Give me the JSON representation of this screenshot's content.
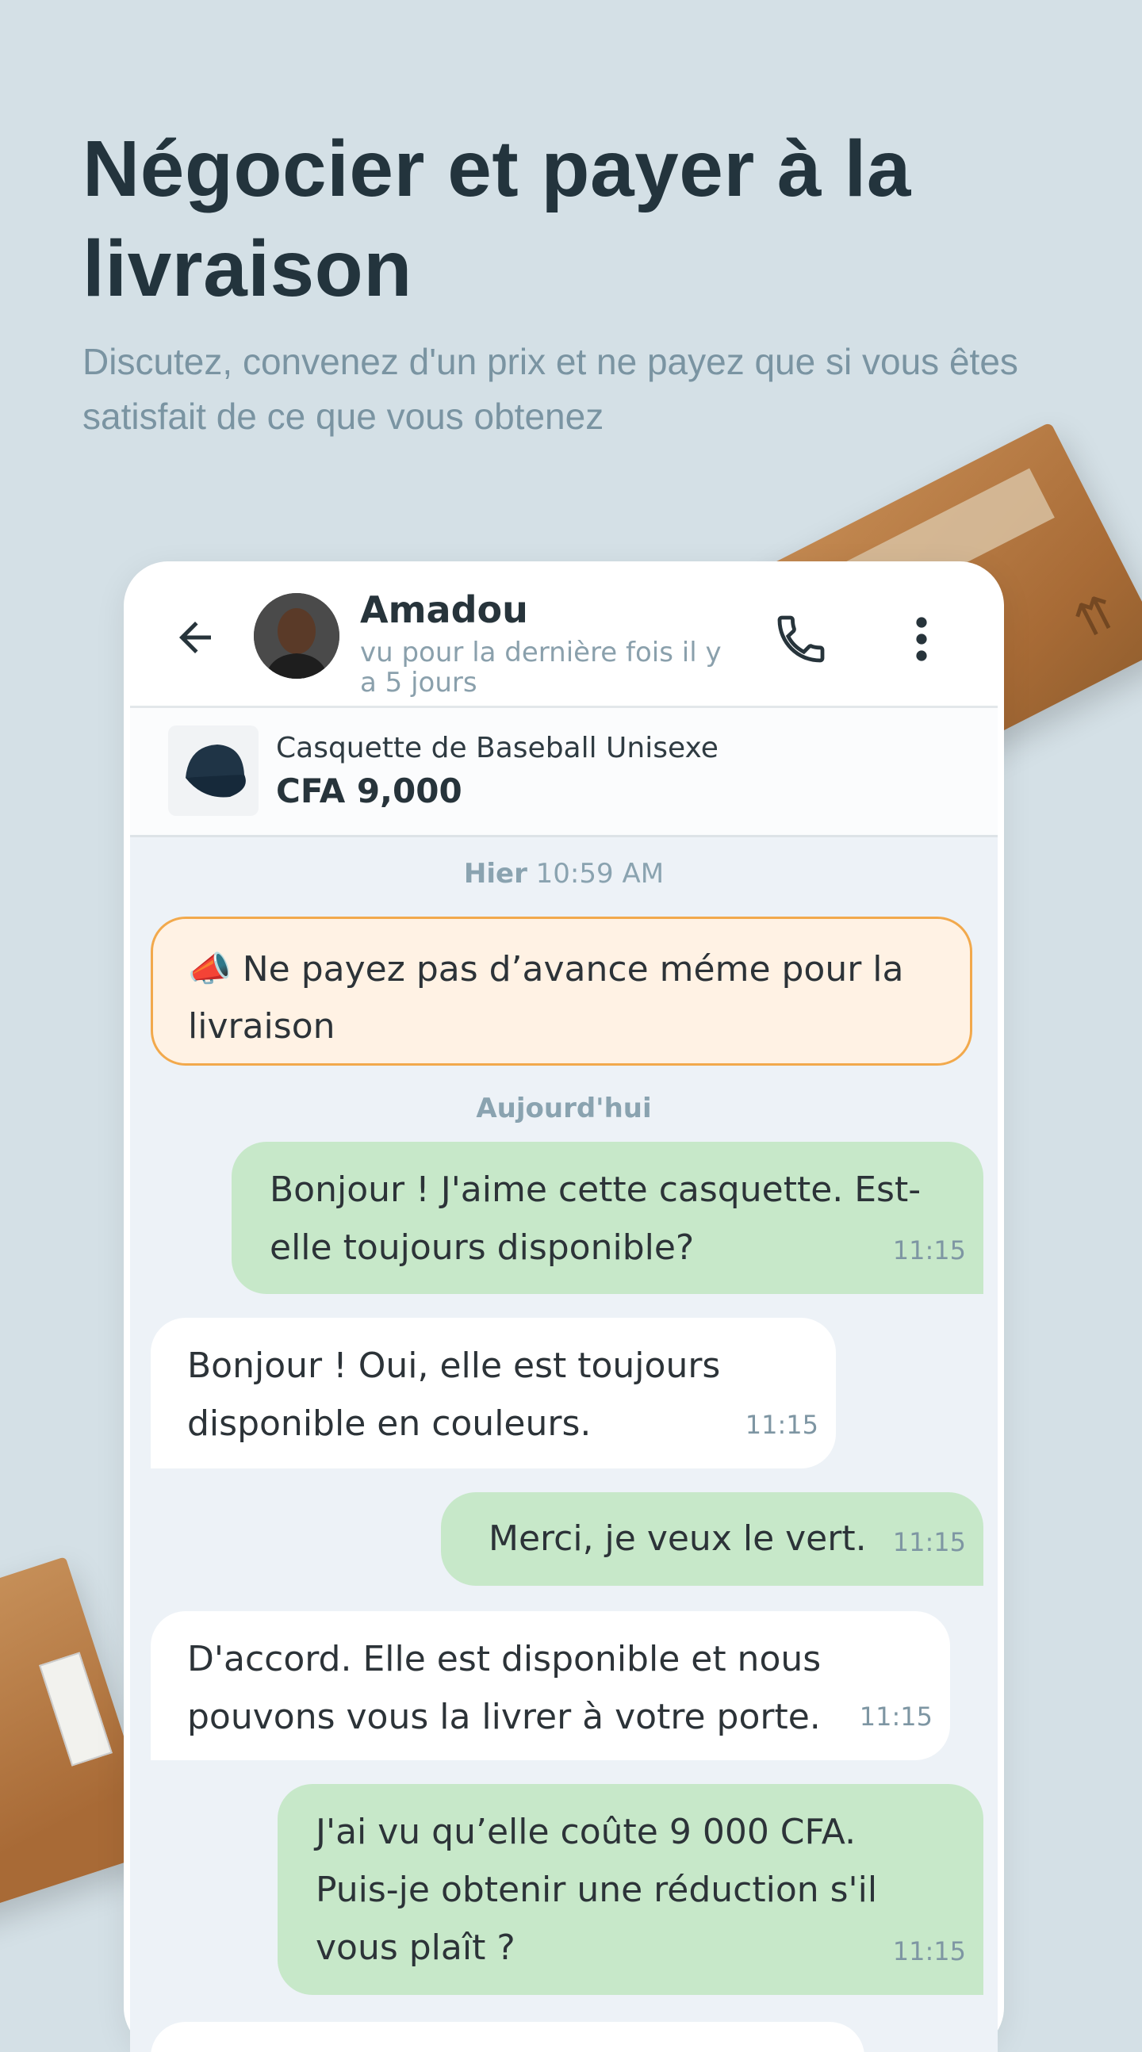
{
  "hero": {
    "title": "Négocier et payer à la livraison",
    "subtitle": "Discutez, convenez d'un prix et ne payez que si vous êtes satisfait de ce que vous obtenez"
  },
  "chat_header": {
    "contact_name": "Amadou",
    "last_seen": "vu pour la dernière fois il y a 5 jours",
    "icons": [
      "back-arrow-icon",
      "phone-icon",
      "more-vertical-icon"
    ]
  },
  "product": {
    "title": "Casquette de Baseball Unisexe",
    "price": "CFA 9,000"
  },
  "chat": {
    "separator_yesterday": {
      "day": "Hier",
      "time": "10:59 AM"
    },
    "safety_notice": "📣 Ne payez pas d’avance méme pour la livraison",
    "separator_today": "Aujourd'hui",
    "messages": [
      {
        "direction": "out",
        "text": "Bonjour ! J'aime cette casquette. Est-elle toujours disponible?",
        "time": "11:15"
      },
      {
        "direction": "in",
        "text": "Bonjour ! Oui, elle est toujours disponible en couleurs.",
        "time": "11:15"
      },
      {
        "direction": "out",
        "text": "Merci, je veux le vert.",
        "time": "11:15"
      },
      {
        "direction": "in",
        "text": "D'accord. Elle est disponible et nous pouvons vous la livrer à votre porte.",
        "time": "11:15"
      },
      {
        "direction": "out",
        "text": "J'ai vu qu’elle coûte 9 000 CFA. Puis-je obtenir une réduction s'il vous plaît ?",
        "time": "11:15"
      }
    ]
  },
  "colors": {
    "background": "#d4e0e6",
    "outgoing_bubble": "#c7e8c9",
    "incoming_bubble": "#ffffff",
    "notice_border": "#f2a94c",
    "notice_background": "#fff2e4"
  }
}
